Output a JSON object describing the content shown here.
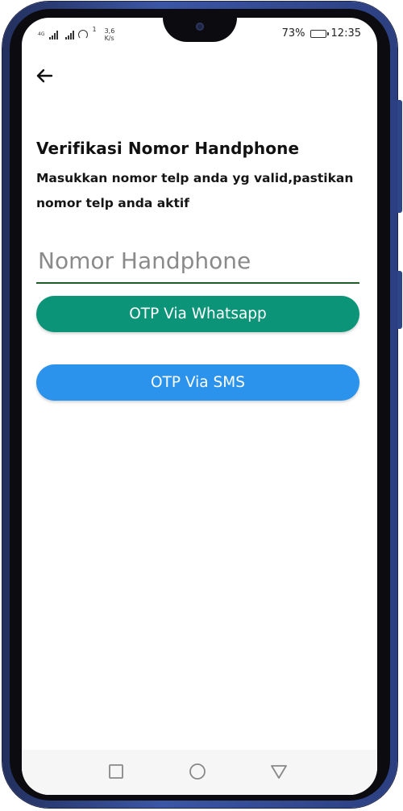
{
  "status_bar": {
    "sim1_label": "4G",
    "sim2_label": "",
    "hotspot_badge": "1",
    "speed_value": "3,6",
    "speed_unit": "K/s",
    "battery_percent": "73%",
    "battery_level": 0.73,
    "time": "12:35"
  },
  "header": {
    "back_icon": "arrow-left-icon"
  },
  "content": {
    "title": "Verifikasi Nomor Handphone",
    "subtitle": "Masukkan nomor telp anda yg valid,pastikan nomor telp anda aktif"
  },
  "phone_input": {
    "value": "",
    "placeholder": "Nomor Handphone"
  },
  "buttons": {
    "whatsapp_label": "OTP Via Whatsapp",
    "sms_label": "OTP Via SMS"
  },
  "colors": {
    "whatsapp_button": "#0b9478",
    "sms_button": "#2b93ec",
    "input_underline": "#1e5e26",
    "phone_frame": "#3b56a6"
  },
  "nav_bar": {
    "recent_icon": "square-icon",
    "home_icon": "circle-icon",
    "back_icon": "triangle-icon"
  }
}
